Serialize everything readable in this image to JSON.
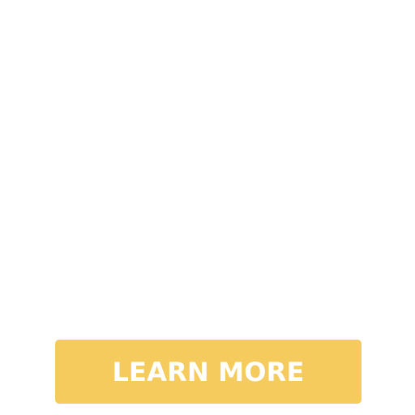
{
  "cta": {
    "label": "LEARN MORE",
    "background_color": "#F6CB5E",
    "text_color": "#FFFFFF"
  },
  "page": {
    "background_color": "#FFFFFF"
  }
}
